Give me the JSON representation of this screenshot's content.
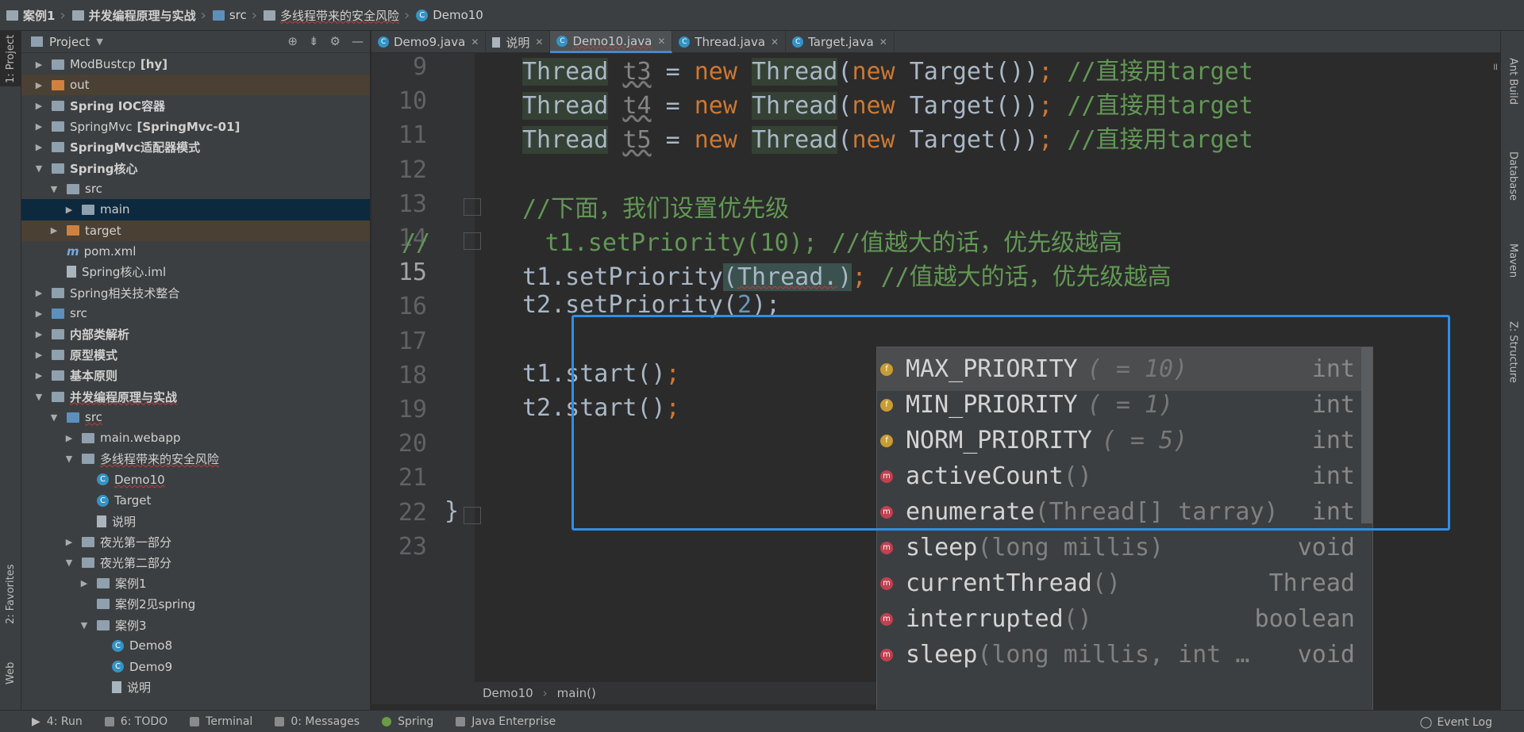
{
  "breadcrumb": {
    "items": [
      {
        "label": "案例1",
        "icon": "folder-icon",
        "bold": true
      },
      {
        "label": "并发编程原理与实战",
        "icon": "folder-icon",
        "bold": true
      },
      {
        "label": "src",
        "icon": "source-folder-icon",
        "bold": false
      },
      {
        "label": "多线程带来的安全风险",
        "icon": "package-icon",
        "bold": false
      },
      {
        "label": "Demo10",
        "icon": "java-class-icon",
        "bold": false
      }
    ]
  },
  "left_strip": {
    "project": "1: Project",
    "favorites": "2: Favorites",
    "web": "Web"
  },
  "right_strip": {
    "ant": "Ant Build",
    "database": "Database",
    "maven": "Maven",
    "structure": "Z: Structure"
  },
  "project": {
    "title": "Project",
    "tree": [
      {
        "label": "ModBustcp",
        "suffix": "[hy]",
        "depth": 0,
        "expand": "collapsed",
        "icon": "module"
      },
      {
        "label": "out",
        "depth": 0,
        "expand": "collapsed",
        "icon": "orange",
        "highlight": true
      },
      {
        "label": "Spring IOC容器",
        "depth": 0,
        "expand": "collapsed",
        "icon": "module",
        "bold": true
      },
      {
        "label": "SpringMvc",
        "suffix": "[SpringMvc-01]",
        "depth": 0,
        "expand": "collapsed",
        "icon": "module"
      },
      {
        "label": "SpringMvc适配器模式",
        "depth": 0,
        "expand": "collapsed",
        "icon": "module",
        "bold": true
      },
      {
        "label": "Spring核心",
        "depth": 0,
        "expand": "expanded",
        "icon": "module",
        "bold": true
      },
      {
        "label": "src",
        "depth": 1,
        "expand": "expanded",
        "icon": "folder"
      },
      {
        "label": "main",
        "depth": 2,
        "expand": "collapsed",
        "icon": "folder",
        "selected": true
      },
      {
        "label": "target",
        "depth": 1,
        "expand": "collapsed",
        "icon": "orange",
        "highlight": true
      },
      {
        "label": "pom.xml",
        "depth": 1,
        "expand": "none",
        "icon": "maven"
      },
      {
        "label": "Spring核心.iml",
        "depth": 1,
        "expand": "none",
        "icon": "file"
      },
      {
        "label": "Spring相关技术整合",
        "depth": 0,
        "expand": "collapsed",
        "icon": "module"
      },
      {
        "label": "src",
        "depth": 0,
        "expand": "collapsed",
        "icon": "blue"
      },
      {
        "label": "内部类解析",
        "depth": 0,
        "expand": "collapsed",
        "icon": "module",
        "bold": true
      },
      {
        "label": "原型模式",
        "depth": 0,
        "expand": "collapsed",
        "icon": "module",
        "bold": true
      },
      {
        "label": "基本原则",
        "depth": 0,
        "expand": "collapsed",
        "icon": "module",
        "bold": true
      },
      {
        "label": "并发编程原理与实战",
        "depth": 0,
        "expand": "expanded",
        "icon": "module",
        "bold": true,
        "squiggle": true
      },
      {
        "label": "src",
        "depth": 1,
        "expand": "expanded",
        "icon": "blue",
        "squiggle": true
      },
      {
        "label": "main.webapp",
        "depth": 2,
        "expand": "collapsed",
        "icon": "folder"
      },
      {
        "label": "多线程带来的安全风险",
        "depth": 2,
        "expand": "expanded",
        "icon": "folder",
        "squiggle": true
      },
      {
        "label": "Demo10",
        "depth": 3,
        "expand": "none",
        "icon": "class",
        "squiggle": true
      },
      {
        "label": "Target",
        "depth": 3,
        "expand": "none",
        "icon": "class"
      },
      {
        "label": "说明",
        "depth": 3,
        "expand": "none",
        "icon": "file"
      },
      {
        "label": "夜光第一部分",
        "depth": 2,
        "expand": "collapsed",
        "icon": "folder"
      },
      {
        "label": "夜光第二部分",
        "depth": 2,
        "expand": "expanded",
        "icon": "folder"
      },
      {
        "label": "案例1",
        "depth": 3,
        "expand": "collapsed",
        "icon": "folder"
      },
      {
        "label": "案例2见spring",
        "depth": 3,
        "expand": "none",
        "icon": "folder"
      },
      {
        "label": "案例3",
        "depth": 3,
        "expand": "expanded",
        "icon": "folder"
      },
      {
        "label": "Demo8",
        "depth": 4,
        "expand": "none",
        "icon": "class"
      },
      {
        "label": "Demo9",
        "depth": 4,
        "expand": "none",
        "icon": "class"
      },
      {
        "label": "说明",
        "depth": 4,
        "expand": "none",
        "icon": "file"
      }
    ]
  },
  "tabs": [
    {
      "label": "Demo9.java",
      "icon": "java-class-icon",
      "active": false
    },
    {
      "label": "说明",
      "icon": "text-file-icon",
      "active": false
    },
    {
      "label": "Demo10.java",
      "icon": "java-class-icon",
      "active": true
    },
    {
      "label": "Thread.java",
      "icon": "java-class-icon",
      "active": false
    },
    {
      "label": "Target.java",
      "icon": "java-class-icon",
      "active": false
    }
  ],
  "editor": {
    "current_line": "15",
    "lines": [
      {
        "n": "9",
        "var": "t3",
        "comment": "//直接用target"
      },
      {
        "n": "10",
        "var": "t4",
        "comment": "//直接用target"
      },
      {
        "n": "11",
        "var": "t5",
        "comment": "//直接用target"
      },
      {
        "n": "12"
      },
      {
        "n": "13",
        "comment13": "//下面，我们设置优先级"
      },
      {
        "n": "14",
        "commented": "//        t1.setPriority(10); //值越大的话，优先级越高"
      },
      {
        "n": "15",
        "code": "t1.setPriority",
        "arg": "Thread.",
        "comment": "//值越大的话，优先级越高"
      },
      {
        "n": "16",
        "code": "t2.setPriority(",
        "num": "2",
        "tail": ");"
      },
      {
        "n": "17"
      },
      {
        "n": "18",
        "code": "t1.start()",
        "tail": ";"
      },
      {
        "n": "19",
        "code": "t2.start()",
        "tail": ";"
      },
      {
        "n": "20"
      },
      {
        "n": "21"
      },
      {
        "n": "22",
        "code": "}"
      },
      {
        "n": "23"
      }
    ],
    "tokens": {
      "thread": "Thread",
      "new": "new",
      "target": "Target()",
      "eq": "=",
      "semi": ";"
    }
  },
  "completion": {
    "items": [
      {
        "name": "MAX_PRIORITY",
        "hint": "( = 10)",
        "type": "int",
        "kind": "f",
        "selected": true
      },
      {
        "name": "MIN_PRIORITY",
        "hint": "( = 1)",
        "type": "int",
        "kind": "f"
      },
      {
        "name": "NORM_PRIORITY",
        "hint": "( = 5)",
        "type": "int",
        "kind": "f"
      },
      {
        "name": "activeCount",
        "params": "()",
        "type": "int",
        "kind": "m"
      },
      {
        "name": "enumerate",
        "params": "(Thread[] tarray)",
        "type": "int",
        "kind": "m"
      },
      {
        "name": "sleep",
        "params": "(long millis)",
        "type": "void",
        "kind": "m"
      },
      {
        "name": "currentThread",
        "params": "()",
        "type": "Thread",
        "kind": "m"
      },
      {
        "name": "interrupted",
        "params": "()",
        "type": "boolean",
        "kind": "m"
      },
      {
        "name": "sleep",
        "params": "(long millis, int …",
        "type": "void",
        "kind": "m"
      }
    ]
  },
  "editor_breadcrumb": {
    "class": "Demo10",
    "method": "main()"
  },
  "bottom": {
    "run": "4: Run",
    "todo": "6: TODO",
    "terminal": "Terminal",
    "messages": "0: Messages",
    "spring": "Spring",
    "java_enterprise": "Java Enterprise",
    "event_log": "Event Log"
  },
  "colors": {
    "accent": "#2d8fe6",
    "keyword": "#cc7832",
    "comment": "#629755",
    "number": "#6897bb",
    "selection": "#0d293e"
  }
}
